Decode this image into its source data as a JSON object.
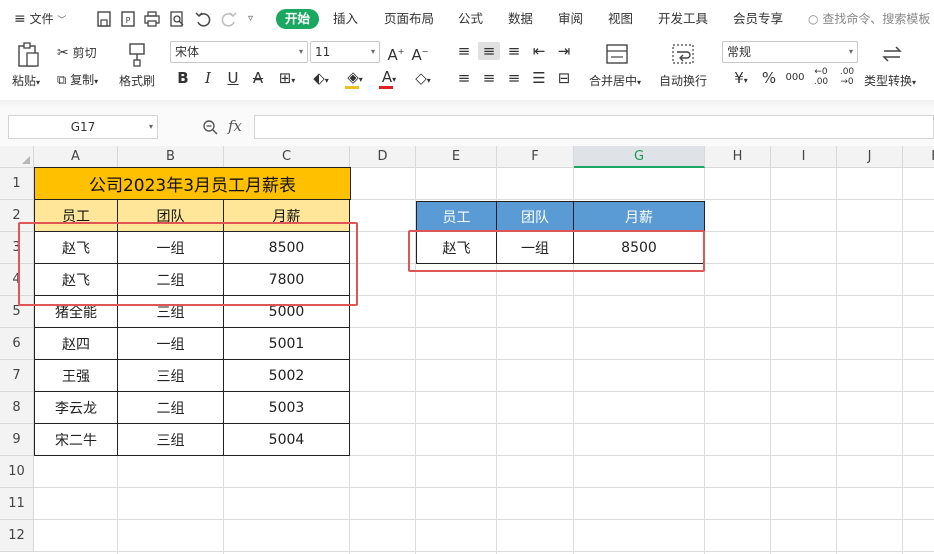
{
  "menubar": {
    "file": "文件",
    "tabs": [
      "开始",
      "插入",
      "页面布局",
      "公式",
      "数据",
      "审阅",
      "视图",
      "开发工具",
      "会员专享"
    ],
    "search_placeholder": "查找命令、搜索模板"
  },
  "ribbon": {
    "paste": "粘贴",
    "cut": "剪切",
    "copy": "复制",
    "format_painter": "格式刷",
    "font_name": "宋体",
    "font_size": "11",
    "merge_center": "合并居中",
    "wrap_text": "自动换行",
    "number_format": "常规",
    "type_convert": "类型转换"
  },
  "formula_bar": {
    "name_box": "G17",
    "fx": "fx",
    "value": ""
  },
  "sheet": {
    "columns": [
      "A",
      "B",
      "C",
      "D",
      "E",
      "F",
      "G",
      "H",
      "I",
      "J",
      "K"
    ],
    "rows": [
      "1",
      "2",
      "3",
      "4",
      "5",
      "6",
      "7",
      "8",
      "9",
      "10",
      "11",
      "12"
    ],
    "selected_column": "G",
    "table_title": "公司2023年3月员工月薪表",
    "headers": [
      "员工",
      "团队",
      "月薪"
    ],
    "data": [
      [
        "赵飞",
        "一组",
        "8500"
      ],
      [
        "赵飞",
        "二组",
        "7800"
      ],
      [
        "猪全能",
        "三组",
        "5000"
      ],
      [
        "赵四",
        "一组",
        "5001"
      ],
      [
        "王强",
        "三组",
        "5002"
      ],
      [
        "李云龙",
        "二组",
        "5003"
      ],
      [
        "宋二牛",
        "三组",
        "5004"
      ]
    ],
    "lookup_headers": [
      "员工",
      "团队",
      "月薪"
    ],
    "lookup_result": [
      "赵飞",
      "一组",
      "8500"
    ]
  },
  "colors": {
    "accent": "#1aa760",
    "title_fill": "#ffc000",
    "header_fill": "#ffe699",
    "lookup_header_fill": "#5b9bd5",
    "highlight_box": "#e05555"
  }
}
